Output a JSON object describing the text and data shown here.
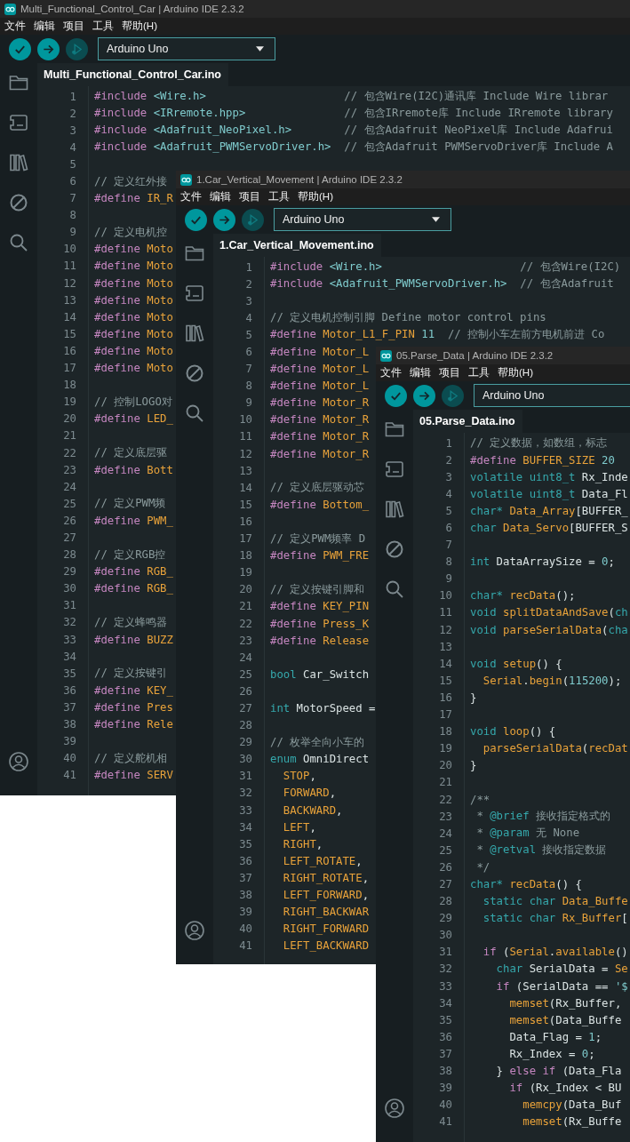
{
  "windows": [
    {
      "title": "Multi_Functional_Control_Car | Arduino IDE 2.3.2",
      "menu": [
        "文件",
        "编辑",
        "项目",
        "工具",
        "帮助(H)"
      ],
      "toolbar_buttons": [
        {
          "kind": "verify",
          "disabled": false
        },
        {
          "kind": "upload",
          "disabled": false
        },
        {
          "kind": "debug",
          "disabled": true
        }
      ],
      "board": "Arduino Uno",
      "tabs": [
        {
          "label": "Multi_Functional_Control_Car.ino",
          "selected": true
        }
      ],
      "lines": [
        {
          "number": "1",
          "tokens": [
            {
              "kind": "directive",
              "text": "#include"
            },
            {
              "kind": "header",
              "text": " <Wire.h>"
            },
            {
              "kind": "comment",
              "text": "                     // 包含Wire(I2C)通讯库 Include Wire librar"
            }
          ]
        },
        {
          "number": "2",
          "tokens": [
            {
              "kind": "directive",
              "text": "#include"
            },
            {
              "kind": "header",
              "text": " <IRremote.hpp>"
            },
            {
              "kind": "comment",
              "text": "               // 包含IRremote库 Include IRremote library"
            }
          ]
        },
        {
          "number": "3",
          "tokens": [
            {
              "kind": "directive",
              "text": "#include"
            },
            {
              "kind": "header",
              "text": " <Adafruit_NeoPixel.h>"
            },
            {
              "kind": "comment",
              "text": "        // 包含Adafruit NeoPixel库 Include Adafrui"
            }
          ]
        },
        {
          "number": "4",
          "tokens": [
            {
              "kind": "directive",
              "text": "#include"
            },
            {
              "kind": "header",
              "text": " <Adafruit_PWMServoDriver.h>"
            },
            {
              "kind": "comment",
              "text": "  // 包含Adafruit PWMServoDriver库 Include A"
            }
          ]
        },
        {
          "number": "5"
        },
        {
          "number": "6",
          "tokens": [
            {
              "kind": "comment",
              "text": "// 定义红外接"
            }
          ]
        },
        {
          "number": "7",
          "tokens": [
            {
              "kind": "directive",
              "text": "#define"
            },
            {
              "kind": "macro",
              "text": " IR_R"
            }
          ]
        },
        {
          "number": "8"
        },
        {
          "number": "9",
          "tokens": [
            {
              "kind": "comment",
              "text": "// 定义电机控"
            }
          ]
        },
        {
          "number": "10",
          "tokens": [
            {
              "kind": "directive",
              "text": "#define"
            },
            {
              "kind": "macro",
              "text": " Moto"
            }
          ]
        },
        {
          "number": "11",
          "tokens": [
            {
              "kind": "directive",
              "text": "#define"
            },
            {
              "kind": "macro",
              "text": " Moto"
            }
          ]
        },
        {
          "number": "12",
          "tokens": [
            {
              "kind": "directive",
              "text": "#define"
            },
            {
              "kind": "macro",
              "text": " Moto"
            }
          ]
        },
        {
          "number": "13",
          "tokens": [
            {
              "kind": "directive",
              "text": "#define"
            },
            {
              "kind": "macro",
              "text": " Moto"
            }
          ]
        },
        {
          "number": "14",
          "tokens": [
            {
              "kind": "directive",
              "text": "#define"
            },
            {
              "kind": "macro",
              "text": " Moto"
            }
          ]
        },
        {
          "number": "15",
          "tokens": [
            {
              "kind": "directive",
              "text": "#define"
            },
            {
              "kind": "macro",
              "text": " Moto"
            }
          ]
        },
        {
          "number": "16",
          "tokens": [
            {
              "kind": "directive",
              "text": "#define"
            },
            {
              "kind": "macro",
              "text": " Moto"
            }
          ]
        },
        {
          "number": "17",
          "tokens": [
            {
              "kind": "directive",
              "text": "#define"
            },
            {
              "kind": "macro",
              "text": " Moto"
            }
          ]
        },
        {
          "number": "18"
        },
        {
          "number": "19",
          "tokens": [
            {
              "kind": "comment",
              "text": "// 控制LOGO对"
            }
          ]
        },
        {
          "number": "20",
          "tokens": [
            {
              "kind": "directive",
              "text": "#define"
            },
            {
              "kind": "macro",
              "text": " LED_"
            }
          ]
        },
        {
          "number": "21"
        },
        {
          "number": "22",
          "tokens": [
            {
              "kind": "comment",
              "text": "// 定义底层驱"
            }
          ]
        },
        {
          "number": "23",
          "tokens": [
            {
              "kind": "directive",
              "text": "#define"
            },
            {
              "kind": "macro",
              "text": " Bott"
            }
          ]
        },
        {
          "number": "24"
        },
        {
          "number": "25",
          "tokens": [
            {
              "kind": "comment",
              "text": "// 定义PWM频"
            }
          ]
        },
        {
          "number": "26",
          "tokens": [
            {
              "kind": "directive",
              "text": "#define"
            },
            {
              "kind": "macro",
              "text": " PWM_"
            }
          ]
        },
        {
          "number": "27"
        },
        {
          "number": "28",
          "tokens": [
            {
              "kind": "comment",
              "text": "// 定义RGB控"
            }
          ]
        },
        {
          "number": "29",
          "tokens": [
            {
              "kind": "directive",
              "text": "#define"
            },
            {
              "kind": "macro",
              "text": " RGB_"
            }
          ]
        },
        {
          "number": "30",
          "tokens": [
            {
              "kind": "directive",
              "text": "#define"
            },
            {
              "kind": "macro",
              "text": " RGB_"
            }
          ]
        },
        {
          "number": "31"
        },
        {
          "number": "32",
          "tokens": [
            {
              "kind": "comment",
              "text": "// 定义蜂鸣器"
            }
          ]
        },
        {
          "number": "33",
          "tokens": [
            {
              "kind": "directive",
              "text": "#define"
            },
            {
              "kind": "macro",
              "text": " BUZZ"
            }
          ]
        },
        {
          "number": "34"
        },
        {
          "number": "35",
          "tokens": [
            {
              "kind": "comment",
              "text": "// 定义按键引"
            }
          ]
        },
        {
          "number": "36",
          "tokens": [
            {
              "kind": "directive",
              "text": "#define"
            },
            {
              "kind": "macro",
              "text": " KEY_"
            }
          ]
        },
        {
          "number": "37",
          "tokens": [
            {
              "kind": "directive",
              "text": "#define"
            },
            {
              "kind": "macro",
              "text": " Pres"
            }
          ]
        },
        {
          "number": "38",
          "tokens": [
            {
              "kind": "directive",
              "text": "#define"
            },
            {
              "kind": "macro",
              "text": " Rele"
            }
          ]
        },
        {
          "number": "39"
        },
        {
          "number": "40",
          "tokens": [
            {
              "kind": "comment",
              "text": "// 定义舵机相"
            }
          ]
        },
        {
          "number": "41",
          "tokens": [
            {
              "kind": "directive",
              "text": "#define"
            },
            {
              "kind": "macro",
              "text": " SERV"
            }
          ]
        }
      ]
    },
    {
      "title": "1.Car_Vertical_Movement | Arduino IDE 2.3.2",
      "menu": [
        "文件",
        "编辑",
        "项目",
        "工具",
        "帮助(H)"
      ],
      "toolbar_buttons": [
        {
          "kind": "verify",
          "disabled": false
        },
        {
          "kind": "upload",
          "disabled": false
        },
        {
          "kind": "debug",
          "disabled": true
        }
      ],
      "board": "Arduino Uno",
      "tabs": [
        {
          "label": "1.Car_Vertical_Movement.ino",
          "selected": true
        }
      ],
      "lines": [
        {
          "number": "1",
          "tokens": [
            {
              "kind": "directive",
              "text": "#include"
            },
            {
              "kind": "header",
              "text": " <Wire.h>"
            },
            {
              "kind": "comment",
              "text": "                     // 包含Wire(I2C)"
            }
          ]
        },
        {
          "number": "2",
          "tokens": [
            {
              "kind": "directive",
              "text": "#include"
            },
            {
              "kind": "header",
              "text": " <Adafruit_PWMServoDriver.h>"
            },
            {
              "kind": "comment",
              "text": "  // 包含Adafruit"
            }
          ]
        },
        {
          "number": "3"
        },
        {
          "number": "4",
          "tokens": [
            {
              "kind": "comment",
              "text": "// 定义电机控制引脚 Define motor control pins"
            }
          ]
        },
        {
          "number": "5",
          "tokens": [
            {
              "kind": "directive",
              "text": "#define"
            },
            {
              "kind": "macro",
              "text": " Motor_L1_F_PIN"
            },
            {
              "kind": "number",
              "text": " 11"
            },
            {
              "kind": "comment",
              "text": "  // 控制小车左前方电机前进 Co"
            }
          ]
        },
        {
          "number": "6",
          "tokens": [
            {
              "kind": "directive",
              "text": "#define"
            },
            {
              "kind": "macro",
              "text": " Motor_L"
            }
          ]
        },
        {
          "number": "7",
          "tokens": [
            {
              "kind": "directive",
              "text": "#define"
            },
            {
              "kind": "macro",
              "text": " Motor_L"
            }
          ]
        },
        {
          "number": "8",
          "tokens": [
            {
              "kind": "directive",
              "text": "#define"
            },
            {
              "kind": "macro",
              "text": " Motor_L"
            }
          ]
        },
        {
          "number": "9",
          "tokens": [
            {
              "kind": "directive",
              "text": "#define"
            },
            {
              "kind": "macro",
              "text": " Motor_R"
            }
          ]
        },
        {
          "number": "10",
          "tokens": [
            {
              "kind": "directive",
              "text": "#define"
            },
            {
              "kind": "macro",
              "text": " Motor_R"
            }
          ]
        },
        {
          "number": "11",
          "tokens": [
            {
              "kind": "directive",
              "text": "#define"
            },
            {
              "kind": "macro",
              "text": " Motor_R"
            }
          ]
        },
        {
          "number": "12",
          "tokens": [
            {
              "kind": "directive",
              "text": "#define"
            },
            {
              "kind": "macro",
              "text": " Motor_R"
            }
          ]
        },
        {
          "number": "13"
        },
        {
          "number": "14",
          "tokens": [
            {
              "kind": "comment",
              "text": "// 定义底层驱动芯"
            }
          ]
        },
        {
          "number": "15",
          "tokens": [
            {
              "kind": "directive",
              "text": "#define"
            },
            {
              "kind": "macro",
              "text": " Bottom_"
            }
          ]
        },
        {
          "number": "16"
        },
        {
          "number": "17",
          "tokens": [
            {
              "kind": "comment",
              "text": "// 定义PWM频率 D"
            }
          ]
        },
        {
          "number": "18",
          "tokens": [
            {
              "kind": "directive",
              "text": "#define"
            },
            {
              "kind": "macro",
              "text": " PWM_FRE"
            }
          ]
        },
        {
          "number": "19"
        },
        {
          "number": "20",
          "tokens": [
            {
              "kind": "comment",
              "text": "// 定义按键引脚和"
            }
          ]
        },
        {
          "number": "21",
          "tokens": [
            {
              "kind": "directive",
              "text": "#define"
            },
            {
              "kind": "macro",
              "text": " KEY_PIN"
            }
          ]
        },
        {
          "number": "22",
          "tokens": [
            {
              "kind": "directive",
              "text": "#define"
            },
            {
              "kind": "macro",
              "text": " Press_K"
            }
          ]
        },
        {
          "number": "23",
          "tokens": [
            {
              "kind": "directive",
              "text": "#define"
            },
            {
              "kind": "macro",
              "text": " Release"
            }
          ]
        },
        {
          "number": "24"
        },
        {
          "number": "25",
          "tokens": [
            {
              "kind": "type",
              "text": "bool"
            },
            {
              "kind": "plain",
              "text": " Car_Switch"
            }
          ]
        },
        {
          "number": "26"
        },
        {
          "number": "27",
          "tokens": [
            {
              "kind": "type",
              "text": "int"
            },
            {
              "kind": "plain",
              "text": " MotorSpeed ="
            }
          ]
        },
        {
          "number": "28"
        },
        {
          "number": "29",
          "tokens": [
            {
              "kind": "comment",
              "text": "// 枚举全向小车的"
            }
          ]
        },
        {
          "number": "30",
          "tokens": [
            {
              "kind": "type",
              "text": "enum"
            },
            {
              "kind": "plain",
              "text": " OmniDirect"
            }
          ]
        },
        {
          "number": "31",
          "tokens": [
            {
              "kind": "macro",
              "text": "  STOP"
            },
            {
              "kind": "plain",
              "text": ","
            }
          ]
        },
        {
          "number": "32",
          "tokens": [
            {
              "kind": "macro",
              "text": "  FORWARD"
            },
            {
              "kind": "plain",
              "text": ","
            }
          ]
        },
        {
          "number": "33",
          "tokens": [
            {
              "kind": "macro",
              "text": "  BACKWARD"
            },
            {
              "kind": "plain",
              "text": ","
            }
          ]
        },
        {
          "number": "34",
          "tokens": [
            {
              "kind": "macro",
              "text": "  LEFT"
            },
            {
              "kind": "plain",
              "text": ","
            }
          ]
        },
        {
          "number": "35",
          "tokens": [
            {
              "kind": "macro",
              "text": "  RIGHT"
            },
            {
              "kind": "plain",
              "text": ","
            }
          ]
        },
        {
          "number": "36",
          "tokens": [
            {
              "kind": "macro",
              "text": "  LEFT_ROTATE"
            },
            {
              "kind": "plain",
              "text": ","
            }
          ]
        },
        {
          "number": "37",
          "tokens": [
            {
              "kind": "macro",
              "text": "  RIGHT_ROTATE"
            },
            {
              "kind": "plain",
              "text": ","
            }
          ]
        },
        {
          "number": "38",
          "tokens": [
            {
              "kind": "macro",
              "text": "  LEFT_FORWARD"
            },
            {
              "kind": "plain",
              "text": ","
            }
          ]
        },
        {
          "number": "39",
          "tokens": [
            {
              "kind": "macro",
              "text": "  RIGHT_BACKWAR"
            }
          ]
        },
        {
          "number": "40",
          "tokens": [
            {
              "kind": "macro",
              "text": "  RIGHT_FORWARD"
            }
          ]
        },
        {
          "number": "41",
          "tokens": [
            {
              "kind": "macro",
              "text": "  LEFT_BACKWARD"
            }
          ]
        }
      ]
    },
    {
      "title": "05.Parse_Data | Arduino IDE 2.3.2",
      "menu": [
        "文件",
        "编辑",
        "项目",
        "工具",
        "帮助(H)"
      ],
      "toolbar_buttons": [
        {
          "kind": "verify",
          "disabled": false
        },
        {
          "kind": "upload",
          "disabled": false
        },
        {
          "kind": "debug",
          "disabled": true
        }
      ],
      "board": "Arduino Uno",
      "tabs": [
        {
          "label": "05.Parse_Data.ino",
          "selected": true
        }
      ],
      "lines": [
        {
          "number": "1",
          "tokens": [
            {
              "kind": "comment",
              "text": "// 定义数据，如数组，标志"
            }
          ]
        },
        {
          "number": "2",
          "tokens": [
            {
              "kind": "directive",
              "text": "#define"
            },
            {
              "kind": "macro",
              "text": " BUFFER_SIZE"
            },
            {
              "kind": "number",
              "text": " 20"
            }
          ]
        },
        {
          "number": "3",
          "tokens": [
            {
              "kind": "type",
              "text": "volatile uint8_t"
            },
            {
              "kind": "plain",
              "text": " Rx_Inde"
            }
          ]
        },
        {
          "number": "4",
          "tokens": [
            {
              "kind": "type",
              "text": "volatile uint8_t"
            },
            {
              "kind": "plain",
              "text": " Data_Fl"
            }
          ]
        },
        {
          "number": "5",
          "tokens": [
            {
              "kind": "type",
              "text": "char*"
            },
            {
              "kind": "macro",
              "text": " Data_Array"
            },
            {
              "kind": "plain",
              "text": "[BUFFER_"
            }
          ]
        },
        {
          "number": "6",
          "tokens": [
            {
              "kind": "type",
              "text": "char"
            },
            {
              "kind": "macro",
              "text": " Data_Servo"
            },
            {
              "kind": "plain",
              "text": "[BUFFER_S"
            }
          ]
        },
        {
          "number": "7"
        },
        {
          "number": "8",
          "tokens": [
            {
              "kind": "type",
              "text": "int"
            },
            {
              "kind": "plain",
              "text": " DataArraySize ="
            },
            {
              "kind": "number",
              "text": " 0"
            },
            {
              "kind": "plain",
              "text": ";"
            }
          ]
        },
        {
          "number": "9"
        },
        {
          "number": "10",
          "tokens": [
            {
              "kind": "type",
              "text": "char*"
            },
            {
              "kind": "function",
              "text": " recData"
            },
            {
              "kind": "plain",
              "text": "();"
            }
          ]
        },
        {
          "number": "11",
          "tokens": [
            {
              "kind": "type",
              "text": "void"
            },
            {
              "kind": "function",
              "text": " splitDataAndSave"
            },
            {
              "kind": "plain",
              "text": "("
            },
            {
              "kind": "type",
              "text": "ch"
            }
          ]
        },
        {
          "number": "12",
          "tokens": [
            {
              "kind": "type",
              "text": "void"
            },
            {
              "kind": "function",
              "text": " parseSerialData"
            },
            {
              "kind": "plain",
              "text": "("
            },
            {
              "kind": "type",
              "text": "cha"
            }
          ]
        },
        {
          "number": "13"
        },
        {
          "number": "14",
          "tokens": [
            {
              "kind": "type",
              "text": "void"
            },
            {
              "kind": "function",
              "text": " setup"
            },
            {
              "kind": "plain",
              "text": "() {"
            }
          ]
        },
        {
          "number": "15",
          "tokens": [
            {
              "kind": "function",
              "text": "  Serial"
            },
            {
              "kind": "plain",
              "text": "."
            },
            {
              "kind": "function",
              "text": "begin"
            },
            {
              "kind": "plain",
              "text": "("
            },
            {
              "kind": "number",
              "text": "115200"
            },
            {
              "kind": "plain",
              "text": ");"
            }
          ]
        },
        {
          "number": "16",
          "tokens": [
            {
              "kind": "plain",
              "text": "}"
            }
          ]
        },
        {
          "number": "17"
        },
        {
          "number": "18",
          "tokens": [
            {
              "kind": "type",
              "text": "void"
            },
            {
              "kind": "function",
              "text": " loop"
            },
            {
              "kind": "plain",
              "text": "() {"
            }
          ]
        },
        {
          "number": "19",
          "tokens": [
            {
              "kind": "function",
              "text": "  parseSerialData"
            },
            {
              "kind": "plain",
              "text": "("
            },
            {
              "kind": "function",
              "text": "recDat"
            }
          ]
        },
        {
          "number": "20",
          "tokens": [
            {
              "kind": "plain",
              "text": "}"
            }
          ]
        },
        {
          "number": "21"
        },
        {
          "number": "22",
          "tokens": [
            {
              "kind": "comment",
              "text": "/**"
            }
          ]
        },
        {
          "number": "23",
          "tokens": [
            {
              "kind": "comment",
              "text": " *"
            },
            {
              "kind": "doctag",
              "text": " @brief"
            },
            {
              "kind": "comment",
              "text": " 接收指定格式的"
            }
          ]
        },
        {
          "number": "24",
          "tokens": [
            {
              "kind": "comment",
              "text": " *"
            },
            {
              "kind": "doctag",
              "text": " @param"
            },
            {
              "kind": "comment",
              "text": " 无 None"
            }
          ]
        },
        {
          "number": "25",
          "tokens": [
            {
              "kind": "comment",
              "text": " *"
            },
            {
              "kind": "doctag",
              "text": " @retval"
            },
            {
              "kind": "comment",
              "text": " 接收指定数据"
            }
          ]
        },
        {
          "number": "26",
          "tokens": [
            {
              "kind": "comment",
              "text": " */"
            }
          ]
        },
        {
          "number": "27",
          "tokens": [
            {
              "kind": "type",
              "text": "char*"
            },
            {
              "kind": "function",
              "text": " recData"
            },
            {
              "kind": "plain",
              "text": "() {"
            }
          ]
        },
        {
          "number": "28",
          "tokens": [
            {
              "kind": "type",
              "text": "  static char"
            },
            {
              "kind": "macro",
              "text": " Data_Buffe"
            }
          ]
        },
        {
          "number": "29",
          "tokens": [
            {
              "kind": "type",
              "text": "  static char"
            },
            {
              "kind": "macro",
              "text": " Rx_Buffer"
            },
            {
              "kind": "plain",
              "text": "["
            }
          ]
        },
        {
          "number": "30"
        },
        {
          "number": "31",
          "tokens": [
            {
              "kind": "keyword",
              "text": "  if"
            },
            {
              "kind": "plain",
              "text": " ("
            },
            {
              "kind": "function",
              "text": "Serial"
            },
            {
              "kind": "plain",
              "text": "."
            },
            {
              "kind": "function",
              "text": "available"
            },
            {
              "kind": "plain",
              "text": "()"
            }
          ]
        },
        {
          "number": "32",
          "tokens": [
            {
              "kind": "type",
              "text": "    char"
            },
            {
              "kind": "plain",
              "text": " SerialData ="
            },
            {
              "kind": "function",
              "text": " Se"
            }
          ]
        },
        {
          "number": "33",
          "tokens": [
            {
              "kind": "keyword",
              "text": "    if"
            },
            {
              "kind": "plain",
              "text": " (SerialData =="
            },
            {
              "kind": "string",
              "text": " '$"
            }
          ]
        },
        {
          "number": "34",
          "tokens": [
            {
              "kind": "function",
              "text": "      memset"
            },
            {
              "kind": "plain",
              "text": "(Rx_Buffer,"
            }
          ]
        },
        {
          "number": "35",
          "tokens": [
            {
              "kind": "function",
              "text": "      memset"
            },
            {
              "kind": "plain",
              "text": "(Data_Buffe"
            }
          ]
        },
        {
          "number": "36",
          "tokens": [
            {
              "kind": "plain",
              "text": "      Data_Flag ="
            },
            {
              "kind": "number",
              "text": " 1"
            },
            {
              "kind": "plain",
              "text": ";"
            }
          ]
        },
        {
          "number": "37",
          "tokens": [
            {
              "kind": "plain",
              "text": "      Rx_Index ="
            },
            {
              "kind": "number",
              "text": " 0"
            },
            {
              "kind": "plain",
              "text": ";"
            }
          ]
        },
        {
          "number": "38",
          "tokens": [
            {
              "kind": "plain",
              "text": "    }"
            },
            {
              "kind": "keyword",
              "text": " else if"
            },
            {
              "kind": "plain",
              "text": " (Data_Fla"
            }
          ]
        },
        {
          "number": "39",
          "tokens": [
            {
              "kind": "keyword",
              "text": "      if"
            },
            {
              "kind": "plain",
              "text": " (Rx_Index < BU"
            }
          ]
        },
        {
          "number": "40",
          "tokens": [
            {
              "kind": "function",
              "text": "        memcpy"
            },
            {
              "kind": "plain",
              "text": "(Data_Buf"
            }
          ]
        },
        {
          "number": "41",
          "tokens": [
            {
              "kind": "function",
              "text": "        memset"
            },
            {
              "kind": "plain",
              "text": "(Rx_Buffe"
            }
          ]
        }
      ]
    }
  ]
}
